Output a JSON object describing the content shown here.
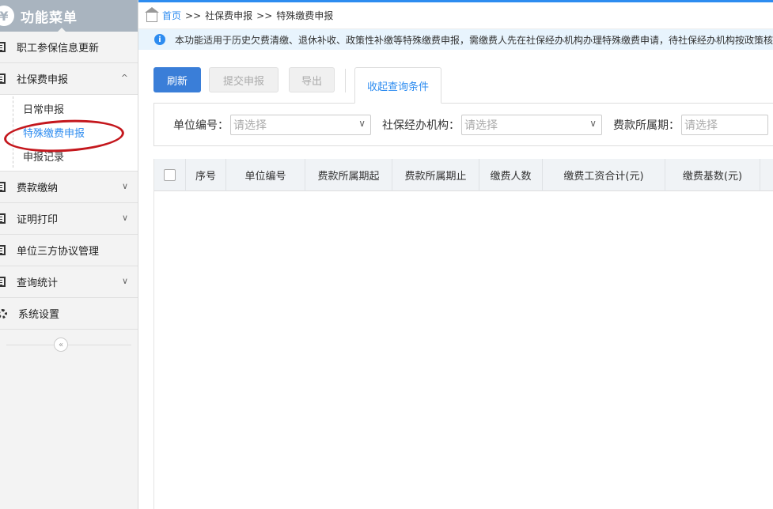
{
  "sidebar": {
    "logo_glyph": "¥",
    "title": "功能菜单",
    "items": [
      {
        "label": "职工参保信息更新",
        "icon": "document-icon"
      },
      {
        "label": "社保费申报",
        "icon": "document-icon",
        "chevron": "^",
        "children": [
          {
            "label": "日常申报"
          },
          {
            "label": "特殊缴费申报",
            "active": true
          },
          {
            "label": "申报记录"
          }
        ]
      },
      {
        "label": "费款缴纳",
        "icon": "document-icon",
        "chevron": "∨"
      },
      {
        "label": "证明打印",
        "icon": "document-icon",
        "chevron": "∨"
      },
      {
        "label": "单位三方协议管理",
        "icon": "document-icon"
      },
      {
        "label": "查询统计",
        "icon": "chart-icon",
        "chevron": "∨"
      },
      {
        "label": "系统设置",
        "icon": "gear-icon"
      }
    ],
    "collapse_glyph": "«"
  },
  "breadcrumb": {
    "home": "首页",
    "sep": ">>",
    "level1": "社保费申报",
    "level2": "特殊缴费申报"
  },
  "notice": {
    "icon_glyph": "i",
    "text": "本功能适用于历史欠费清缴、退休补收、政策性补缴等特殊缴费申报，需缴费人先在社保经办机构办理特殊缴费申请，待社保经办机构按政策核"
  },
  "toolbar": {
    "refresh": "刷新",
    "submit": "提交申报",
    "export": "导出",
    "collapse_query": "收起查询条件"
  },
  "query": {
    "unit_no_label": "单位编号：",
    "unit_no_placeholder": "请选择",
    "agency_label": "社保经办机构：",
    "agency_placeholder": "请选择",
    "period_label": "费款所属期：",
    "period_placeholder": "请选择",
    "arrow_glyph": "∨"
  },
  "table": {
    "columns": [
      "序号",
      "单位编号",
      "费款所属期起",
      "费款所属期止",
      "缴费人数",
      "缴费工资合计(元)",
      "缴费基数(元)"
    ],
    "rows": []
  },
  "colors": {
    "accent": "#2d8cf0",
    "primary_button": "#3a7ed8",
    "highlight_annotation": "#c4171d",
    "sidebar_header": "#a9b4bf"
  }
}
